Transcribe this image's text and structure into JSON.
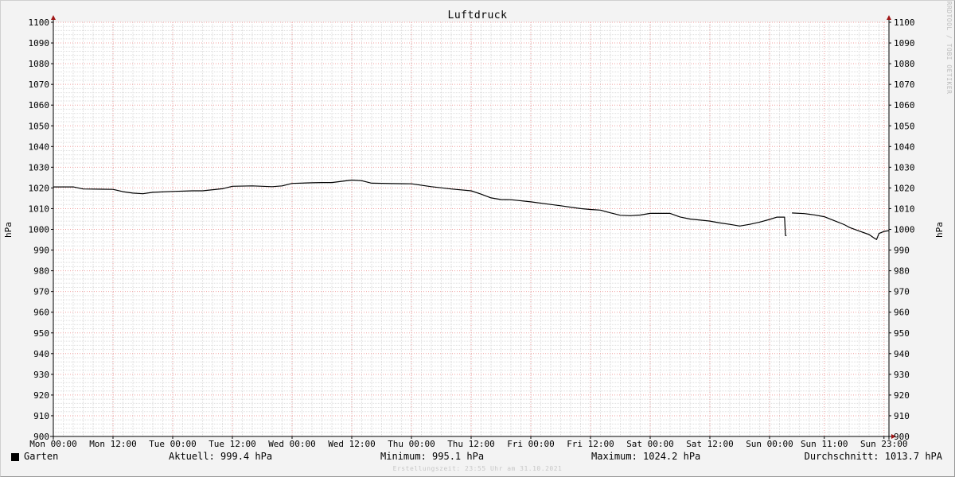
{
  "chart_data": {
    "type": "line",
    "title": "Luftdruck",
    "ylabel": "hPa",
    "ylim": [
      900,
      1100
    ],
    "y_ticks": [
      900,
      910,
      920,
      930,
      940,
      950,
      960,
      970,
      980,
      990,
      1000,
      1010,
      1020,
      1030,
      1040,
      1050,
      1060,
      1070,
      1080,
      1090,
      1100
    ],
    "x_ticks": [
      "Mon 00:00",
      "Mon 12:00",
      "Tue 00:00",
      "Tue 12:00",
      "Wed 00:00",
      "Wed 12:00",
      "Thu 00:00",
      "Thu 12:00",
      "Fri 00:00",
      "Fri 12:00",
      "Sat 00:00",
      "Sat 12:00",
      "Sun 00:00",
      "Sun 11:00",
      "Sun 23:00"
    ],
    "x_tick_hours": [
      0,
      12,
      24,
      36,
      48,
      60,
      72,
      84,
      96,
      108,
      120,
      132,
      144,
      155,
      167
    ],
    "grid": true,
    "series": [
      {
        "name": "Garten",
        "color": "#000000",
        "segments": [
          [
            [
              0,
              1020.5
            ],
            [
              4,
              1020.5
            ],
            [
              6,
              1019.5
            ],
            [
              12,
              1019.3
            ],
            [
              14,
              1018.2
            ],
            [
              16,
              1017.5
            ],
            [
              18,
              1017.2
            ],
            [
              20,
              1017.9
            ],
            [
              24,
              1018.3
            ],
            [
              28,
              1018.6
            ],
            [
              30,
              1018.6
            ],
            [
              34,
              1019.6
            ],
            [
              36,
              1020.8
            ],
            [
              40,
              1021.0
            ],
            [
              44,
              1020.6
            ],
            [
              46,
              1021.0
            ],
            [
              48,
              1022.2
            ],
            [
              52,
              1022.5
            ],
            [
              54,
              1022.6
            ],
            [
              56,
              1022.6
            ],
            [
              60,
              1023.8
            ],
            [
              62,
              1023.5
            ],
            [
              64,
              1022.3
            ],
            [
              68,
              1022.1
            ],
            [
              72,
              1022.0
            ],
            [
              76,
              1020.6
            ],
            [
              80,
              1019.5
            ],
            [
              84,
              1018.6
            ],
            [
              86,
              1017.0
            ],
            [
              88,
              1015.2
            ],
            [
              90,
              1014.4
            ],
            [
              92,
              1014.3
            ],
            [
              96,
              1013.3
            ],
            [
              100,
              1012.0
            ],
            [
              102,
              1011.4
            ],
            [
              106,
              1010.0
            ],
            [
              108,
              1009.6
            ],
            [
              110,
              1009.3
            ],
            [
              112,
              1008.0
            ],
            [
              114,
              1006.8
            ],
            [
              116,
              1006.6
            ],
            [
              118,
              1006.9
            ],
            [
              120,
              1007.7
            ],
            [
              124,
              1007.7
            ],
            [
              126,
              1006.0
            ],
            [
              128,
              1005.0
            ],
            [
              132,
              1004.0
            ],
            [
              134,
              1003.1
            ],
            [
              136,
              1002.4
            ],
            [
              138,
              1001.6
            ],
            [
              140,
              1002.4
            ],
            [
              142,
              1003.5
            ],
            [
              144,
              1004.8
            ],
            [
              145.5,
              1005.9
            ],
            [
              147,
              1005.9
            ],
            [
              147.2,
              997.0
            ],
            [
              147.4,
              997.0
            ]
          ],
          [
            [
              148.5,
              1007.9
            ],
            [
              151,
              1007.6
            ],
            [
              153,
              1007.0
            ],
            [
              155,
              1006.1
            ],
            [
              157,
              1004.2
            ],
            [
              159,
              1002.3
            ],
            [
              160,
              1001.0
            ],
            [
              162,
              999.2
            ],
            [
              164,
              997.5
            ],
            [
              165,
              995.8
            ],
            [
              165.5,
              995.1
            ],
            [
              166,
              998.0
            ],
            [
              167,
              999.0
            ],
            [
              168,
              999.4
            ]
          ]
        ]
      }
    ]
  },
  "watermark": "RRDTOOL / TOBI OETIKER",
  "legend": {
    "series_name": "Garten",
    "aktuell": "Aktuell: 999.4 hPa",
    "minimum": "Minimum: 995.1 hPa",
    "maximum": "Maximum: 1024.2 hPa",
    "durchschnitt": "Durchschnitt: 1013.7 hPA"
  },
  "created": "Erstellungszeit: 23:55 Uhr am 31.10.2021"
}
